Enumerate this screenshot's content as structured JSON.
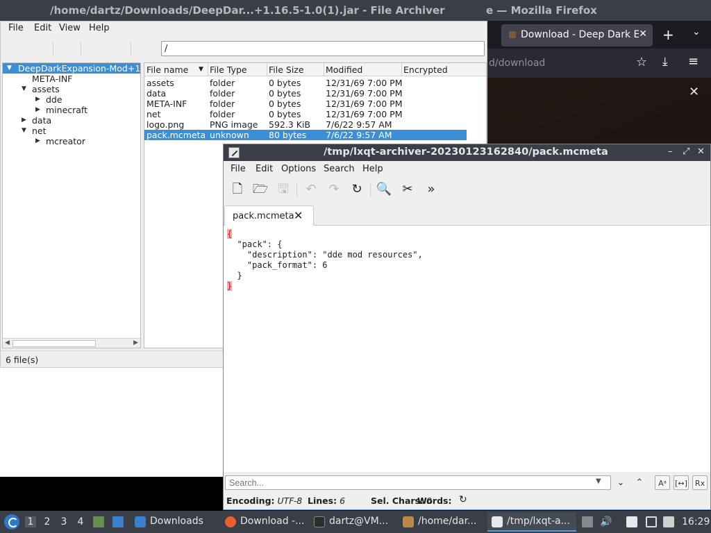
{
  "topbar": {
    "archiver_title": "/home/dartz/Downloads/DeepDar...+1.16.5-1.0(1).jar - File Archiver",
    "firefox_title": "e — Mozilla Firefox"
  },
  "firefox": {
    "tab_label": "Download - Deep Dark E",
    "tab_close": "✕",
    "new_tab": "+",
    "list_tabs": "⌄",
    "url_fragment": "d/download",
    "star_icon": "☆",
    "download_icon": "⤓",
    "menu_icon": "≡",
    "close_icon": "✕"
  },
  "archiver": {
    "menu": [
      "File",
      "Edit",
      "View",
      "Help"
    ],
    "path": "/",
    "tree": [
      {
        "label": "DeepDarkExpansion-Mod+1.",
        "level": 0,
        "arrow": "▼",
        "selected": true
      },
      {
        "label": "META-INF",
        "level": 1,
        "arrow": "",
        "selected": false
      },
      {
        "label": "assets",
        "level": 1,
        "arrow": "▼",
        "selected": false
      },
      {
        "label": "dde",
        "level": 2,
        "arrow": "▶",
        "selected": false
      },
      {
        "label": "minecraft",
        "level": 2,
        "arrow": "▶",
        "selected": false
      },
      {
        "label": "data",
        "level": 1,
        "arrow": "▶",
        "selected": false
      },
      {
        "label": "net",
        "level": 1,
        "arrow": "▼",
        "selected": false
      },
      {
        "label": "mcreator",
        "level": 2,
        "arrow": "▶",
        "selected": false
      }
    ],
    "columns": [
      "File name",
      "File Type",
      "File Size",
      "Modified",
      "Encrypted"
    ],
    "sort_arrow": "▼",
    "files": [
      {
        "name": "assets",
        "type": "folder",
        "size": "0 bytes",
        "modified": "12/31/69 7:00 PM",
        "selected": false
      },
      {
        "name": "data",
        "type": "folder",
        "size": "0 bytes",
        "modified": "12/31/69 7:00 PM",
        "selected": false
      },
      {
        "name": "META-INF",
        "type": "folder",
        "size": "0 bytes",
        "modified": "12/31/69 7:00 PM",
        "selected": false
      },
      {
        "name": "net",
        "type": "folder",
        "size": "0 bytes",
        "modified": "12/31/69 7:00 PM",
        "selected": false
      },
      {
        "name": "logo.png",
        "type": "PNG image",
        "size": "592.3 KiB",
        "modified": "7/6/22 9:57 AM",
        "selected": false
      },
      {
        "name": "pack.mcmeta",
        "type": "unknown",
        "size": "80 bytes",
        "modified": "7/6/22 9:57 AM",
        "selected": true
      }
    ],
    "status": "6 file(s)"
  },
  "editor": {
    "title": "/tmp/lxqt-archiver-20230123162840/pack.mcmeta",
    "win_min": "–",
    "win_max": "⤢",
    "win_close": "✕",
    "menu": [
      "File",
      "Edit",
      "Options",
      "Search",
      "Help"
    ],
    "tools": [
      {
        "name": "new-file-icon",
        "glyph": "🗋",
        "disabled": false
      },
      {
        "name": "open-folder-icon",
        "glyph": "🗁",
        "disabled": false
      },
      {
        "name": "save-icon",
        "glyph": "🖫",
        "disabled": true
      },
      {
        "name": "undo-icon",
        "glyph": "↶",
        "disabled": true
      },
      {
        "name": "redo-icon",
        "glyph": "↷",
        "disabled": true
      },
      {
        "name": "reload-icon",
        "glyph": "↻",
        "disabled": false
      },
      {
        "name": "find-icon",
        "glyph": "🔍",
        "disabled": false
      },
      {
        "name": "replace-icon",
        "glyph": "✂",
        "disabled": false
      },
      {
        "name": "more-icon",
        "glyph": "»",
        "disabled": false
      }
    ],
    "tab_label": "pack.mcmeta",
    "tab_close": "✕",
    "code": [
      {
        "text": "{",
        "brace": true
      },
      {
        "text": "  \"pack\": {",
        "brace": false
      },
      {
        "text": "    \"description\": \"dde mod resources\",",
        "brace": false
      },
      {
        "text": "    \"pack_format\": 6",
        "brace": false
      },
      {
        "text": "  }",
        "brace": false
      },
      {
        "text": "}",
        "brace": true
      }
    ],
    "search_placeholder": "Search...",
    "search_dropdown": "▼",
    "search_next": "⌄",
    "search_prev": "⌃",
    "case_btn": "Aᵃ",
    "whole_btn": "[↔]",
    "regex_btn": "Rx",
    "status": {
      "encoding_label": "Encoding:",
      "encoding_value": "UTF-8",
      "lines_label": "Lines:",
      "lines_value": "6",
      "sel_label": "Sel. Chars:",
      "sel_value": "0",
      "words_label": "Words:",
      "refresh_icon": "↻"
    }
  },
  "taskbar": {
    "desktops": [
      "1",
      "2",
      "3",
      "4"
    ],
    "tasks": [
      {
        "label": "Downloads",
        "color": "#3d7fcf",
        "active": false
      },
      {
        "label": "Download -...",
        "color": "#e8612c",
        "active": false
      },
      {
        "label": "dartz@VM...",
        "color": "#2b2b2b",
        "active": false
      },
      {
        "label": "/home/dar...",
        "color": "#b88a4a",
        "active": false
      },
      {
        "label": "/tmp/lxqt-a...",
        "color": "#e8e8e8",
        "active": true
      }
    ],
    "clock": "16:29"
  }
}
